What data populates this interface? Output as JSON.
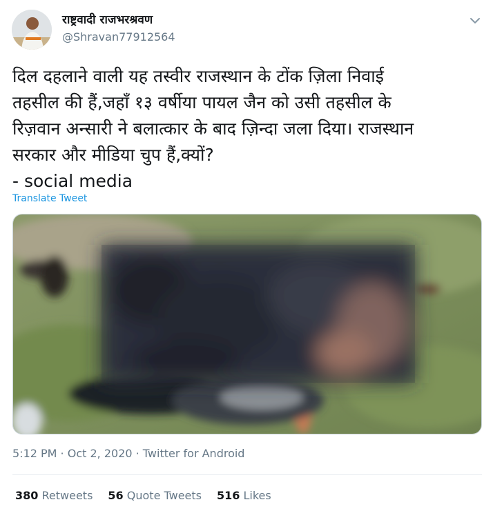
{
  "author": {
    "display_name": "राष्ट्रवादी राजभरश्रवण",
    "handle": "@Shravan77912564"
  },
  "tweet": {
    "text": "दिल दहलाने वाली यह तस्वीर राजस्थान के टोंक ज़िला निवाई\nतहसील की हैं,जहाँ १३ वर्षीया पायल जैन को उसी तहसील के\nरिज़वान अन्सारी ने बलात्कार के बाद ज़िन्दा जला दिया। राजस्थान\nसरकार और मीडिया चुप हैं,क्यों?\n- social media",
    "translate_label": "Translate Tweet",
    "meta": "5:12 PM · Oct 2, 2020 · Twitter for Android"
  },
  "media": {
    "description_icon": "blurred-photo"
  },
  "stats": {
    "retweets_count": "380",
    "retweets_label": "Retweets",
    "quotes_count": "56",
    "quotes_label": "Quote Tweets",
    "likes_count": "516",
    "likes_label": "Likes"
  },
  "colors": {
    "link": "#1b95e0",
    "secondary_text": "#657786",
    "primary_text": "#14171a"
  }
}
